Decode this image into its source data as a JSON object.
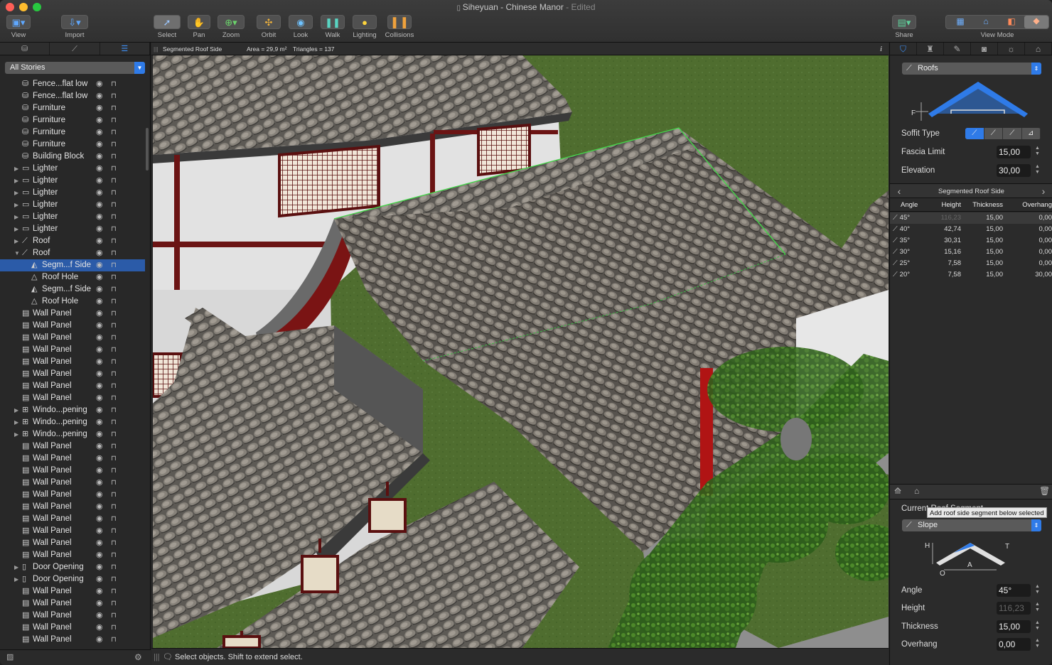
{
  "window": {
    "title": "Siheyuan - Chinese Manor",
    "edited": " - Edited"
  },
  "toolbar": {
    "view": "View",
    "import": "Import",
    "select": "Select",
    "pan": "Pan",
    "zoom": "Zoom",
    "orbit": "Orbit",
    "look": "Look",
    "walk": "Walk",
    "lighting": "Lighting",
    "collisions": "Collisions",
    "share": "Share",
    "view_mode": "View Mode"
  },
  "sidebar": {
    "stories_filter": "All Stories",
    "rows": [
      {
        "label": "Fence...flat low",
        "type": "furniture",
        "indent": 0,
        "disclosure": ""
      },
      {
        "label": "Fence...flat low",
        "type": "furniture",
        "indent": 0,
        "disclosure": ""
      },
      {
        "label": "Furniture",
        "type": "furniture",
        "indent": 0,
        "disclosure": ""
      },
      {
        "label": "Furniture",
        "type": "furniture",
        "indent": 0,
        "disclosure": ""
      },
      {
        "label": "Furniture",
        "type": "furniture",
        "indent": 0,
        "disclosure": ""
      },
      {
        "label": "Furniture",
        "type": "furniture",
        "indent": 0,
        "disclosure": ""
      },
      {
        "label": "Building Block",
        "type": "block",
        "indent": 0,
        "disclosure": ""
      },
      {
        "label": "Lighter",
        "type": "folder",
        "indent": 0,
        "disclosure": "right"
      },
      {
        "label": "Lighter",
        "type": "folder",
        "indent": 0,
        "disclosure": "right"
      },
      {
        "label": "Lighter",
        "type": "folder",
        "indent": 0,
        "disclosure": "right"
      },
      {
        "label": "Lighter",
        "type": "folder",
        "indent": 0,
        "disclosure": "right"
      },
      {
        "label": "Lighter",
        "type": "folder",
        "indent": 0,
        "disclosure": "right"
      },
      {
        "label": "Lighter",
        "type": "folder",
        "indent": 0,
        "disclosure": "right"
      },
      {
        "label": "Roof",
        "type": "roof",
        "indent": 0,
        "disclosure": "right"
      },
      {
        "label": "Roof",
        "type": "roof",
        "indent": 0,
        "disclosure": "down"
      },
      {
        "label": "Segm...f Side",
        "type": "segment",
        "indent": 1,
        "disclosure": "",
        "selected": true
      },
      {
        "label": "Roof Hole",
        "type": "hole",
        "indent": 1,
        "disclosure": ""
      },
      {
        "label": "Segm...f Side",
        "type": "segment",
        "indent": 1,
        "disclosure": ""
      },
      {
        "label": "Roof Hole",
        "type": "hole",
        "indent": 1,
        "disclosure": ""
      },
      {
        "label": "Wall Panel",
        "type": "wall",
        "indent": 0,
        "disclosure": ""
      },
      {
        "label": "Wall Panel",
        "type": "wall",
        "indent": 0,
        "disclosure": ""
      },
      {
        "label": "Wall Panel",
        "type": "wall",
        "indent": 0,
        "disclosure": ""
      },
      {
        "label": "Wall Panel",
        "type": "wall",
        "indent": 0,
        "disclosure": ""
      },
      {
        "label": "Wall Panel",
        "type": "wall",
        "indent": 0,
        "disclosure": ""
      },
      {
        "label": "Wall Panel",
        "type": "wall",
        "indent": 0,
        "disclosure": ""
      },
      {
        "label": "Wall Panel",
        "type": "wall",
        "indent": 0,
        "disclosure": ""
      },
      {
        "label": "Wall Panel",
        "type": "wall",
        "indent": 0,
        "disclosure": ""
      },
      {
        "label": "Windo...pening",
        "type": "window",
        "indent": 0,
        "disclosure": "right"
      },
      {
        "label": "Windo...pening",
        "type": "window",
        "indent": 0,
        "disclosure": "right"
      },
      {
        "label": "Windo...pening",
        "type": "window",
        "indent": 0,
        "disclosure": "right"
      },
      {
        "label": "Wall Panel",
        "type": "wall",
        "indent": 0,
        "disclosure": ""
      },
      {
        "label": "Wall Panel",
        "type": "wall",
        "indent": 0,
        "disclosure": ""
      },
      {
        "label": "Wall Panel",
        "type": "wall",
        "indent": 0,
        "disclosure": ""
      },
      {
        "label": "Wall Panel",
        "type": "wall",
        "indent": 0,
        "disclosure": ""
      },
      {
        "label": "Wall Panel",
        "type": "wall",
        "indent": 0,
        "disclosure": ""
      },
      {
        "label": "Wall Panel",
        "type": "wall",
        "indent": 0,
        "disclosure": ""
      },
      {
        "label": "Wall Panel",
        "type": "wall",
        "indent": 0,
        "disclosure": ""
      },
      {
        "label": "Wall Panel",
        "type": "wall",
        "indent": 0,
        "disclosure": ""
      },
      {
        "label": "Wall Panel",
        "type": "wall",
        "indent": 0,
        "disclosure": ""
      },
      {
        "label": "Wall Panel",
        "type": "wall",
        "indent": 0,
        "disclosure": ""
      },
      {
        "label": "Door Opening",
        "type": "door",
        "indent": 0,
        "disclosure": "right"
      },
      {
        "label": "Door Opening",
        "type": "door",
        "indent": 0,
        "disclosure": "right"
      },
      {
        "label": "Wall Panel",
        "type": "wall",
        "indent": 0,
        "disclosure": ""
      },
      {
        "label": "Wall Panel",
        "type": "wall",
        "indent": 0,
        "disclosure": ""
      },
      {
        "label": "Wall Panel",
        "type": "wall",
        "indent": 0,
        "disclosure": ""
      },
      {
        "label": "Wall Panel",
        "type": "wall",
        "indent": 0,
        "disclosure": ""
      },
      {
        "label": "Wall Panel",
        "type": "wall",
        "indent": 0,
        "disclosure": ""
      }
    ]
  },
  "viewport": {
    "object_name": "Segmented Roof Side",
    "area": "Area = 29,9 m²",
    "triangles": "Triangles = 137",
    "info_glyph": "i",
    "status_text": "Select objects. Shift to extend select."
  },
  "inspector": {
    "category": "Roofs",
    "diagram_letter_f": "F",
    "soffit_type_label": "Soffit Type",
    "fascia_limit_label": "Fascia Limit",
    "fascia_limit_value": "15,00",
    "elevation_label": "Elevation",
    "elevation_value": "30,00",
    "segment_header": "Segmented Roof Side",
    "table_headers": [
      "Angle",
      "Height",
      "Thickness",
      "Overhang"
    ],
    "table_rows": [
      {
        "angle": "45°",
        "height": "116,23",
        "thickness": "15,00",
        "overhang": "0,00",
        "height_dim": true
      },
      {
        "angle": "40°",
        "height": "42,74",
        "thickness": "15,00",
        "overhang": "0,00",
        "height_dim": false
      },
      {
        "angle": "35°",
        "height": "30,31",
        "thickness": "15,00",
        "overhang": "0,00",
        "height_dim": false
      },
      {
        "angle": "30°",
        "height": "15,16",
        "thickness": "15,00",
        "overhang": "0,00",
        "height_dim": false
      },
      {
        "angle": "25°",
        "height": "7,58",
        "thickness": "15,00",
        "overhang": "0,00",
        "height_dim": false
      },
      {
        "angle": "20°",
        "height": "7,58",
        "thickness": "15,00",
        "overhang": "30,00",
        "height_dim": false
      }
    ],
    "current_segment_label": "Current Roof Segment",
    "tooltip": "Add roof side segment below selected",
    "segment_type": "Slope",
    "seg_diagram": {
      "h": "H",
      "t": "T",
      "a": "A",
      "o": "O"
    },
    "angle_label": "Angle",
    "angle_value": "45°",
    "height_label": "Height",
    "height_value": "116,23",
    "thickness_label": "Thickness",
    "thickness_value": "15,00",
    "overhang_label": "Overhang",
    "overhang_value": "0,00"
  },
  "colors": {
    "accent": "#2f7be8",
    "selection": "#2b5ba8",
    "grass": "#4c6b2c",
    "wall": "#e4e4e4",
    "timber": "#6b1414",
    "roof_tile": "#6a6660",
    "foliage": "#3f7a22"
  }
}
